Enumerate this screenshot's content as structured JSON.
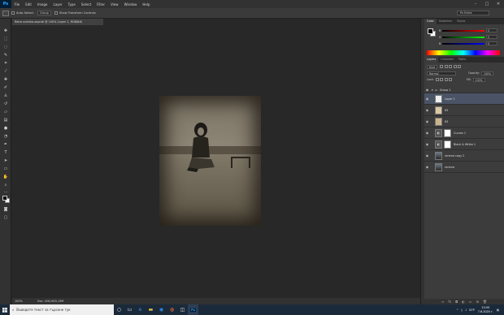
{
  "app": {
    "logo": "Ps"
  },
  "menu": [
    "File",
    "Edit",
    "Image",
    "Layer",
    "Type",
    "Select",
    "Filter",
    "View",
    "Window",
    "Help"
  ],
  "window_controls": {
    "minimize": "–",
    "maximize": "□",
    "close": "✕"
  },
  "options_bar": {
    "auto_select_label": "Auto-Select:",
    "auto_select_value": "Group",
    "show_transform_label": "Show Transform Controls",
    "workspace": "Ps Extra"
  },
  "document": {
    "tab_title": "Retro ucenika.acproti @ 100% (Layer 1, RGB/8#)",
    "zoom": "100%",
    "doc_size": "Doc: 426,0K/5,19M"
  },
  "color_panel": {
    "tabs": [
      "Color",
      "Swatches",
      "Styles"
    ],
    "sliders": [
      {
        "label": "R",
        "value": "0",
        "color": "#c03030"
      },
      {
        "label": "G",
        "value": "0",
        "color": "#30a030"
      },
      {
        "label": "B",
        "value": "0",
        "color": "#3050c0"
      }
    ]
  },
  "layers_panel": {
    "tabs": [
      "Layers",
      "Channels",
      "Paths"
    ],
    "kind_label": "Kind",
    "blend_mode": "Normal",
    "opacity_label": "Opacity:",
    "opacity_value": "100%",
    "lock_label": "Lock:",
    "fill_label": "Fill:",
    "fill_value": "100%",
    "group_name": "Group 1",
    "layers": [
      {
        "name": "Layer 1",
        "thumb": "t-trans",
        "selected": true
      },
      {
        "name": "63",
        "thumb": "t-tan",
        "selected": false
      },
      {
        "name": "63",
        "thumb": "t-tan2",
        "selected": false
      },
      {
        "name": "Curves 1",
        "thumb": "t-adj",
        "mask": true,
        "selected": false
      },
      {
        "name": "Black & White 1",
        "thumb": "t-adj",
        "mask": true,
        "selected": false
      },
      {
        "name": "ranena copy 2",
        "thumb": "t-photo",
        "selected": false
      },
      {
        "name": "ranena",
        "thumb": "t-photo",
        "selected": false
      }
    ]
  },
  "taskbar": {
    "search_placeholder": "Въведете текст за търсене тук",
    "language": "БГР",
    "time": "13:55",
    "date": "7.6.2020 г."
  }
}
